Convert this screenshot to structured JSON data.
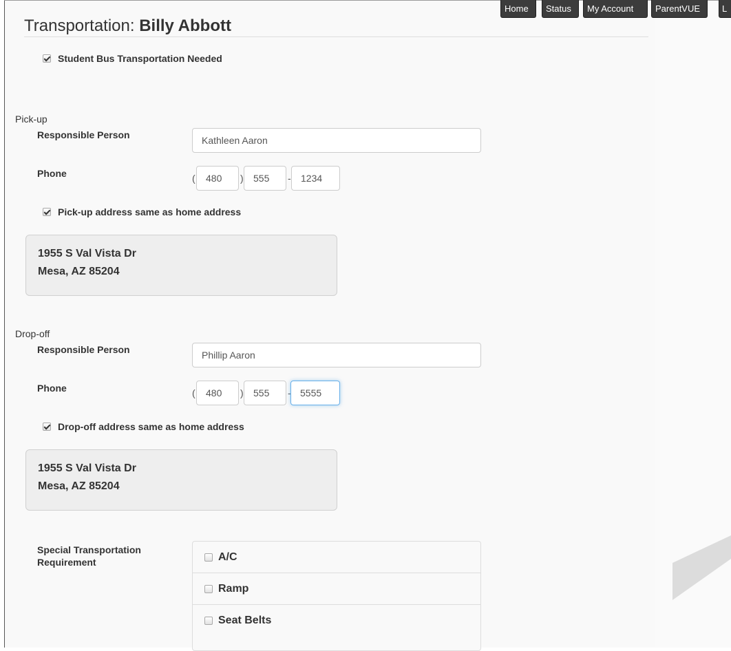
{
  "nav": {
    "items": [
      "Home",
      "Status",
      "My Account",
      "ParentVUE",
      "L"
    ]
  },
  "page": {
    "title_prefix": "Transportation:",
    "student_name": "Billy Abbott"
  },
  "bus_needed": {
    "label": "Student Bus Transportation Needed",
    "checked": true
  },
  "pickup": {
    "section_label": "Pick-up",
    "responsible_label": "Responsible Person",
    "responsible_value": "Kathleen Aaron",
    "phone_label": "Phone",
    "phone": {
      "area": "480",
      "prefix": "555",
      "line": "1234"
    },
    "same_address_label": "Pick-up address same as home address",
    "same_address_checked": true,
    "address_line1": "1955 S Val Vista Dr",
    "address_line2": "Mesa, AZ 85204"
  },
  "dropoff": {
    "section_label": "Drop-off",
    "responsible_label": "Responsible Person",
    "responsible_value": "Phillip Aaron",
    "phone_label": "Phone",
    "phone": {
      "area": "480",
      "prefix": "555",
      "line": "5555"
    },
    "same_address_label": "Drop-off address same as home address",
    "same_address_checked": true,
    "address_line1": "1955 S Val Vista Dr",
    "address_line2": "Mesa, AZ 85204"
  },
  "special": {
    "label_line1": "Special Transportation",
    "label_line2": "Requirement",
    "options": [
      {
        "label": "A/C",
        "checked": false
      },
      {
        "label": "Ramp",
        "checked": false
      },
      {
        "label": "Seat Belts",
        "checked": false
      }
    ]
  },
  "colors": {
    "nav_bg": "#3c3c3c",
    "focus_border": "#66afe9",
    "address_bg": "#eeeeee"
  }
}
